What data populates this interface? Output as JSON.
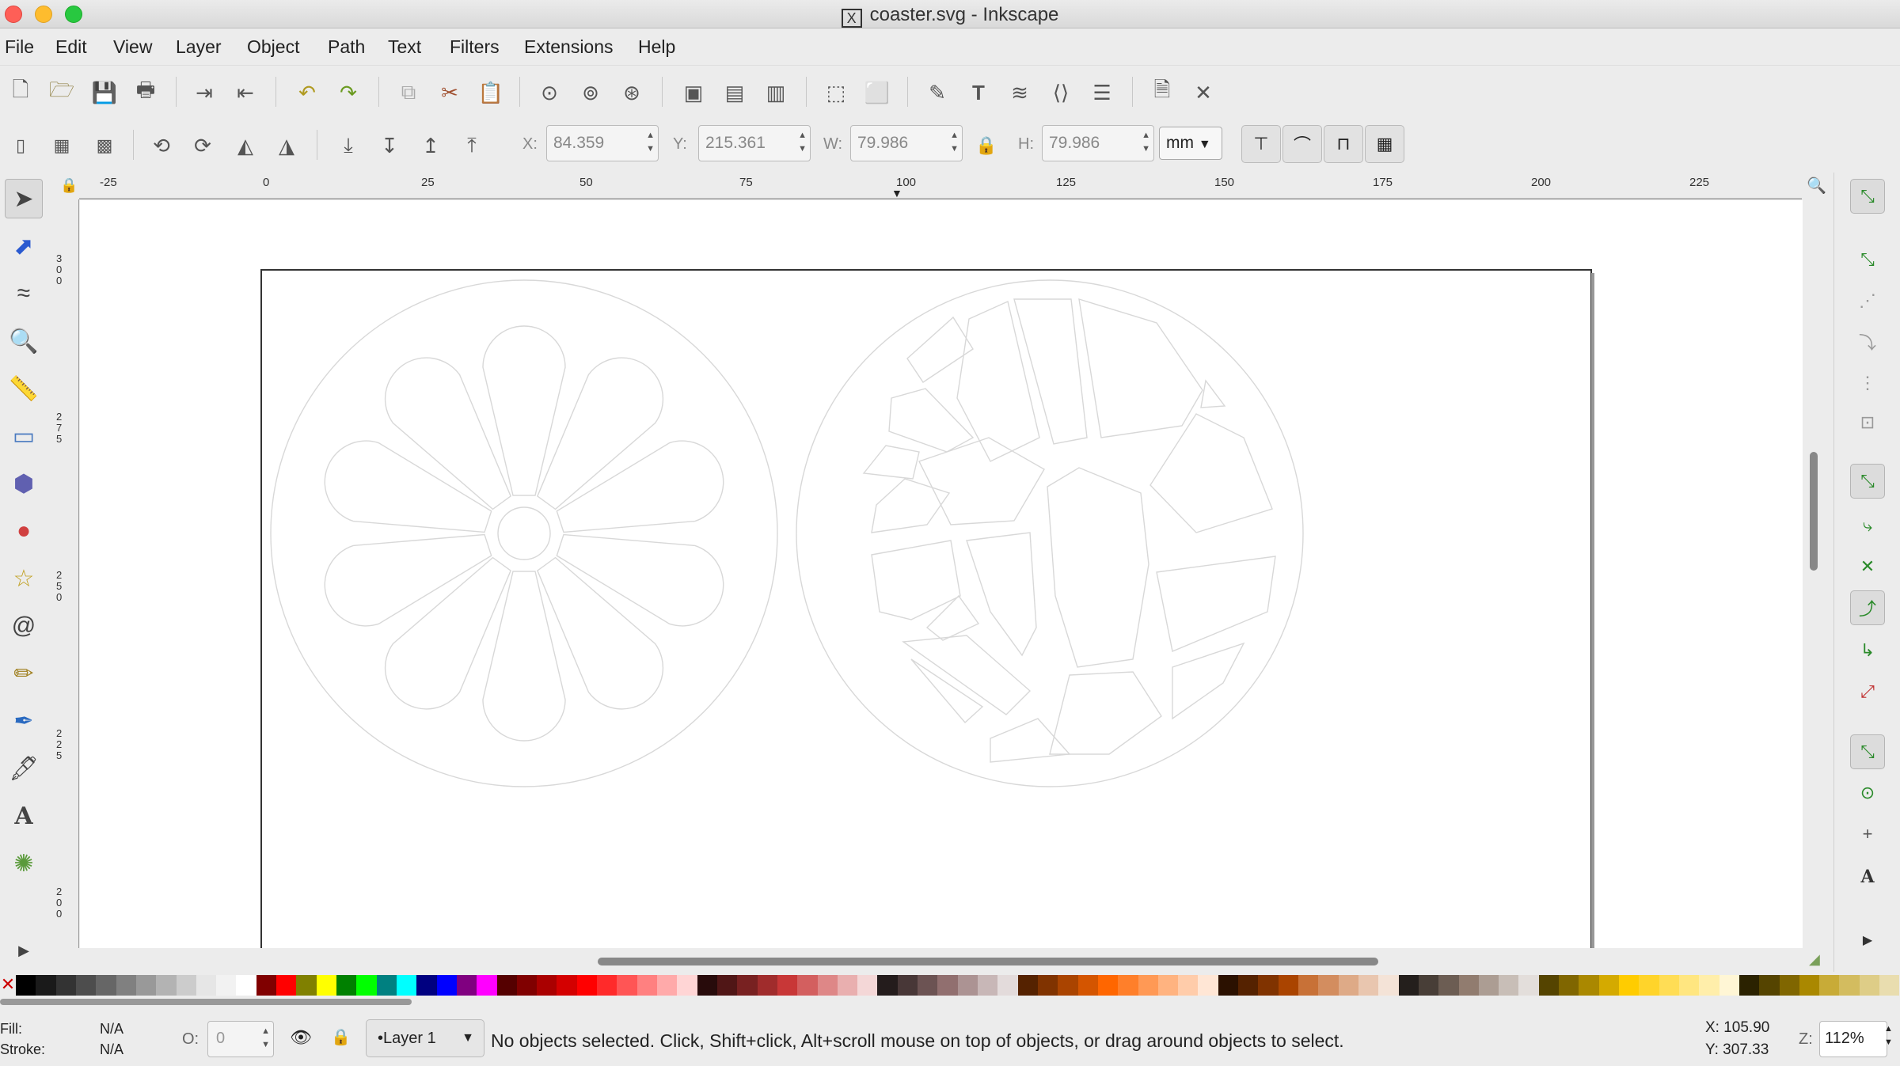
{
  "window": {
    "title": "coaster.svg - Inkscape"
  },
  "menu": [
    "File",
    "Edit",
    "View",
    "Layer",
    "Object",
    "Path",
    "Text",
    "Filters",
    "Extensions",
    "Help"
  ],
  "toolbar2": {
    "x_label": "X:",
    "x_value": "84.359",
    "y_label": "Y:",
    "y_value": "215.361",
    "w_label": "W:",
    "w_value": "79.986",
    "h_label": "H:",
    "h_value": "79.986",
    "unit": "mm"
  },
  "ruler_top": [
    "-25",
    "0",
    "25",
    "50",
    "75",
    "100",
    "125",
    "150",
    "175",
    "200",
    "225"
  ],
  "ruler_left": [
    "300",
    "275",
    "250",
    "225",
    "200"
  ],
  "status": {
    "fill_label": "Fill:",
    "fill_value": "N/A",
    "stroke_label": "Stroke:",
    "stroke_value": "N/A",
    "opacity_label": "O:",
    "opacity_value": "0",
    "layer": "•Layer 1",
    "message": "No objects selected. Click, Shift+click, Alt+scroll mouse on top of objects, or drag around objects to select.",
    "cursor_x": "X: 105.90",
    "cursor_y": "Y: 307.33",
    "zoom_label": "Z:",
    "zoom_value": "112%"
  },
  "palette_colors": [
    "#000000",
    "#1a1a1a",
    "#333333",
    "#4d4d4d",
    "#666666",
    "#808080",
    "#999999",
    "#b3b3b3",
    "#cccccc",
    "#e6e6e6",
    "#f2f2f2",
    "#ffffff",
    "#800000",
    "#ff0000",
    "#808000",
    "#ffff00",
    "#008000",
    "#00ff00",
    "#008080",
    "#00ffff",
    "#000080",
    "#0000ff",
    "#800080",
    "#ff00ff",
    "#550000",
    "#800000",
    "#aa0000",
    "#d40000",
    "#ff0000",
    "#ff2a2a",
    "#ff5555",
    "#ff8080",
    "#ffaaaa",
    "#ffd5d5",
    "#280b0b",
    "#501616",
    "#782121",
    "#a02c2c",
    "#c83737",
    "#d35f5f",
    "#de8787",
    "#e9afaf",
    "#f4d7d7",
    "#241c1c",
    "#483737",
    "#6c5353",
    "#916f6f",
    "#ac9393",
    "#c8b7b7",
    "#e3dbdb",
    "#552200",
    "#803300",
    "#aa4400",
    "#d45500",
    "#ff6600",
    "#ff7f2a",
    "#ff9955",
    "#ffb380",
    "#ffccaa",
    "#ffe6d5",
    "#2b1100",
    "#552200",
    "#803300",
    "#aa4400",
    "#c87137",
    "#d38d5f",
    "#deaa87",
    "#e9c6af",
    "#f4e3d7",
    "#241f1c",
    "#483e37",
    "#6c5d53",
    "#917c6f",
    "#ac9d93",
    "#c8beb7",
    "#e3dedb",
    "#554400",
    "#806600",
    "#aa8800",
    "#d4aa00",
    "#ffcc00",
    "#ffd42a",
    "#ffdd55",
    "#ffe680",
    "#ffeeaa",
    "#fff6d5",
    "#2b2200",
    "#554400",
    "#806600",
    "#aa8800",
    "#c8ab37",
    "#d3bc5f",
    "#decd87",
    "#e9ddaf"
  ]
}
